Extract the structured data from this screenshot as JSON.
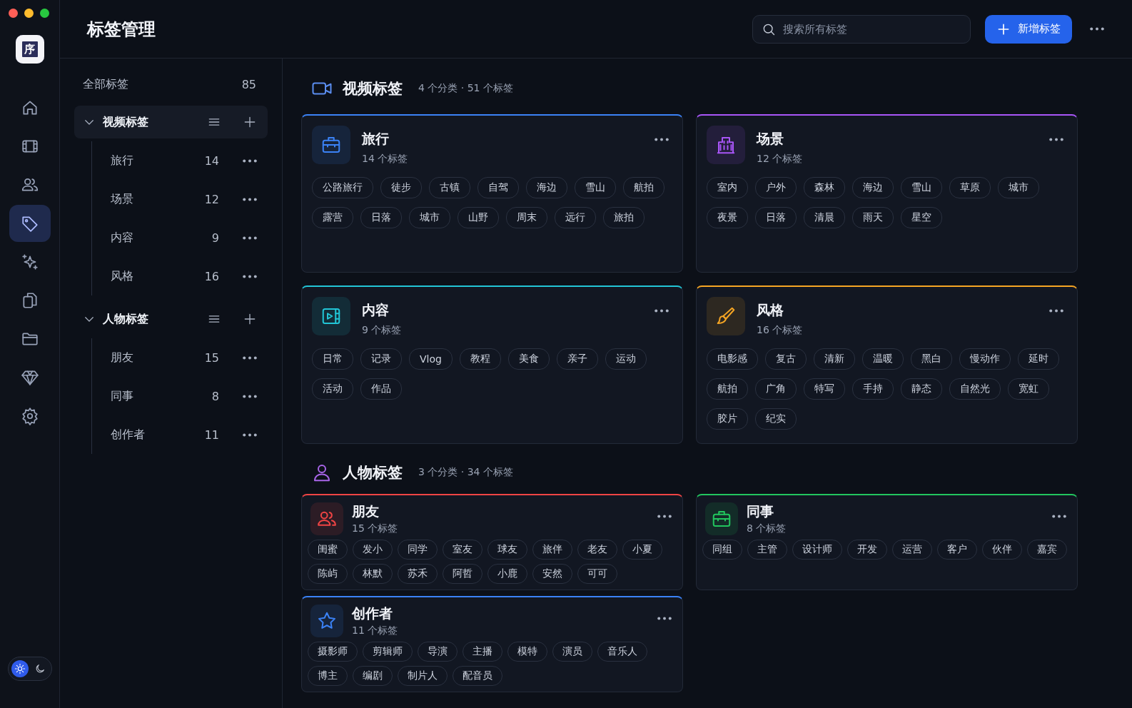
{
  "window": {
    "title": "标签管理"
  },
  "app_logo": "序",
  "search": {
    "placeholder": "搜索所有标签"
  },
  "new_button": {
    "label": "新增标签"
  },
  "rail": {
    "items": [
      {
        "selected": false
      },
      {
        "selected": false
      },
      {
        "selected": false
      },
      {
        "selected": true
      },
      {
        "selected": false
      },
      {
        "selected": false
      },
      {
        "selected": false
      },
      {
        "selected": false
      },
      {
        "selected": false
      }
    ],
    "theme": [
      {
        "selected": true
      },
      {
        "selected": false
      }
    ]
  },
  "sidebar": {
    "all": {
      "label": "全部标签",
      "count": "85"
    },
    "groups": [
      {
        "label": "视频标签",
        "expanded": true,
        "selected": true,
        "children": [
          {
            "label": "旅行",
            "count": "14"
          },
          {
            "label": "场景",
            "count": "12"
          },
          {
            "label": "内容",
            "count": "9"
          },
          {
            "label": "风格",
            "count": "16"
          }
        ]
      },
      {
        "label": "人物标签",
        "expanded": true,
        "selected": false,
        "children": [
          {
            "label": "朋友",
            "count": "15"
          },
          {
            "label": "同事",
            "count": "8"
          },
          {
            "label": "创作者",
            "count": "11"
          }
        ]
      }
    ]
  },
  "sections": [
    {
      "color": "#5b8def",
      "title": "视频标签",
      "summary": "4 个分类 · 51 个标签",
      "cards": [
        {
          "color": "#3b82f6",
          "title": "旅行",
          "count": "14 个标签",
          "tags": [
            "公路旅行",
            "徒步",
            "古镇",
            "自驾",
            "海边",
            "雪山",
            "航拍",
            "露营",
            "日落",
            "城市",
            "山野",
            "周末",
            "远行",
            "旅拍"
          ]
        },
        {
          "color": "#a855f7",
          "title": "场景",
          "count": "12 个标签",
          "tags": [
            "室内",
            "户外",
            "森林",
            "海边",
            "雪山",
            "草原",
            "城市",
            "夜景",
            "日落",
            "清晨",
            "雨天",
            "星空"
          ]
        },
        {
          "color": "#22c5d6",
          "title": "内容",
          "count": "9 个标签",
          "tags": [
            "日常",
            "记录",
            "Vlog",
            "教程",
            "美食",
            "亲子",
            "运动",
            "活动",
            "作品"
          ]
        },
        {
          "color": "#f5a524",
          "title": "风格",
          "count": "16 个标签",
          "tags": [
            "电影感",
            "复古",
            "清新",
            "温暖",
            "黑白",
            "慢动作",
            "延时",
            "航拍",
            "广角",
            "特写",
            "手持",
            "静态",
            "自然光",
            "宽虹",
            "胶片",
            "纪实"
          ]
        }
      ]
    },
    {
      "color": "#a865e8",
      "title": "人物标签",
      "summary": "3 个分类 · 34 个标签",
      "cards": [
        {
          "color": "#ef4444",
          "title": "朋友",
          "count": "15 个标签",
          "tags": [
            "闺蜜",
            "发小",
            "同学",
            "室友",
            "球友",
            "旅伴",
            "老友",
            "小夏",
            "陈屿",
            "林默",
            "苏禾",
            "阿哲",
            "小鹿",
            "安然",
            "可可"
          ]
        },
        {
          "color": "#22c55e",
          "title": "同事",
          "count": "8 个标签",
          "tags": [
            "同组",
            "主管",
            "设计师",
            "开发",
            "运营",
            "客户",
            "伙伴",
            "嘉宾"
          ]
        },
        {
          "color": "#3b82f6",
          "title": "创作者",
          "count": "11 个标签",
          "tags": [
            "摄影师",
            "剪辑师",
            "导演",
            "主播",
            "模特",
            "演员",
            "音乐人",
            "博主",
            "编剧",
            "制片人",
            "配音员"
          ]
        }
      ]
    }
  ]
}
